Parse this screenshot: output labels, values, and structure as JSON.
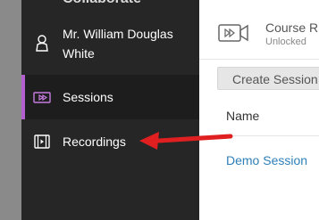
{
  "app": {
    "title_partial": "Collaborate"
  },
  "sidebar": {
    "items": [
      {
        "label": "Mr. William Douglas White",
        "line1": "Mr. William Douglas",
        "line2": "White",
        "icon": "user-icon"
      },
      {
        "label": "Sessions",
        "icon": "video-icon",
        "active": true
      },
      {
        "label": "Recordings",
        "icon": "film-icon"
      }
    ],
    "accent_color": "#b35fcf"
  },
  "main": {
    "room": {
      "title": "Course R",
      "status": "Unlocked",
      "icon": "video-room-icon"
    },
    "create_button_label": "Create Session",
    "table": {
      "column_header": "Name",
      "rows": [
        {
          "name": "Demo Session"
        }
      ]
    }
  },
  "annotation": {
    "arrow_color": "#e02020",
    "target": "Recordings"
  }
}
